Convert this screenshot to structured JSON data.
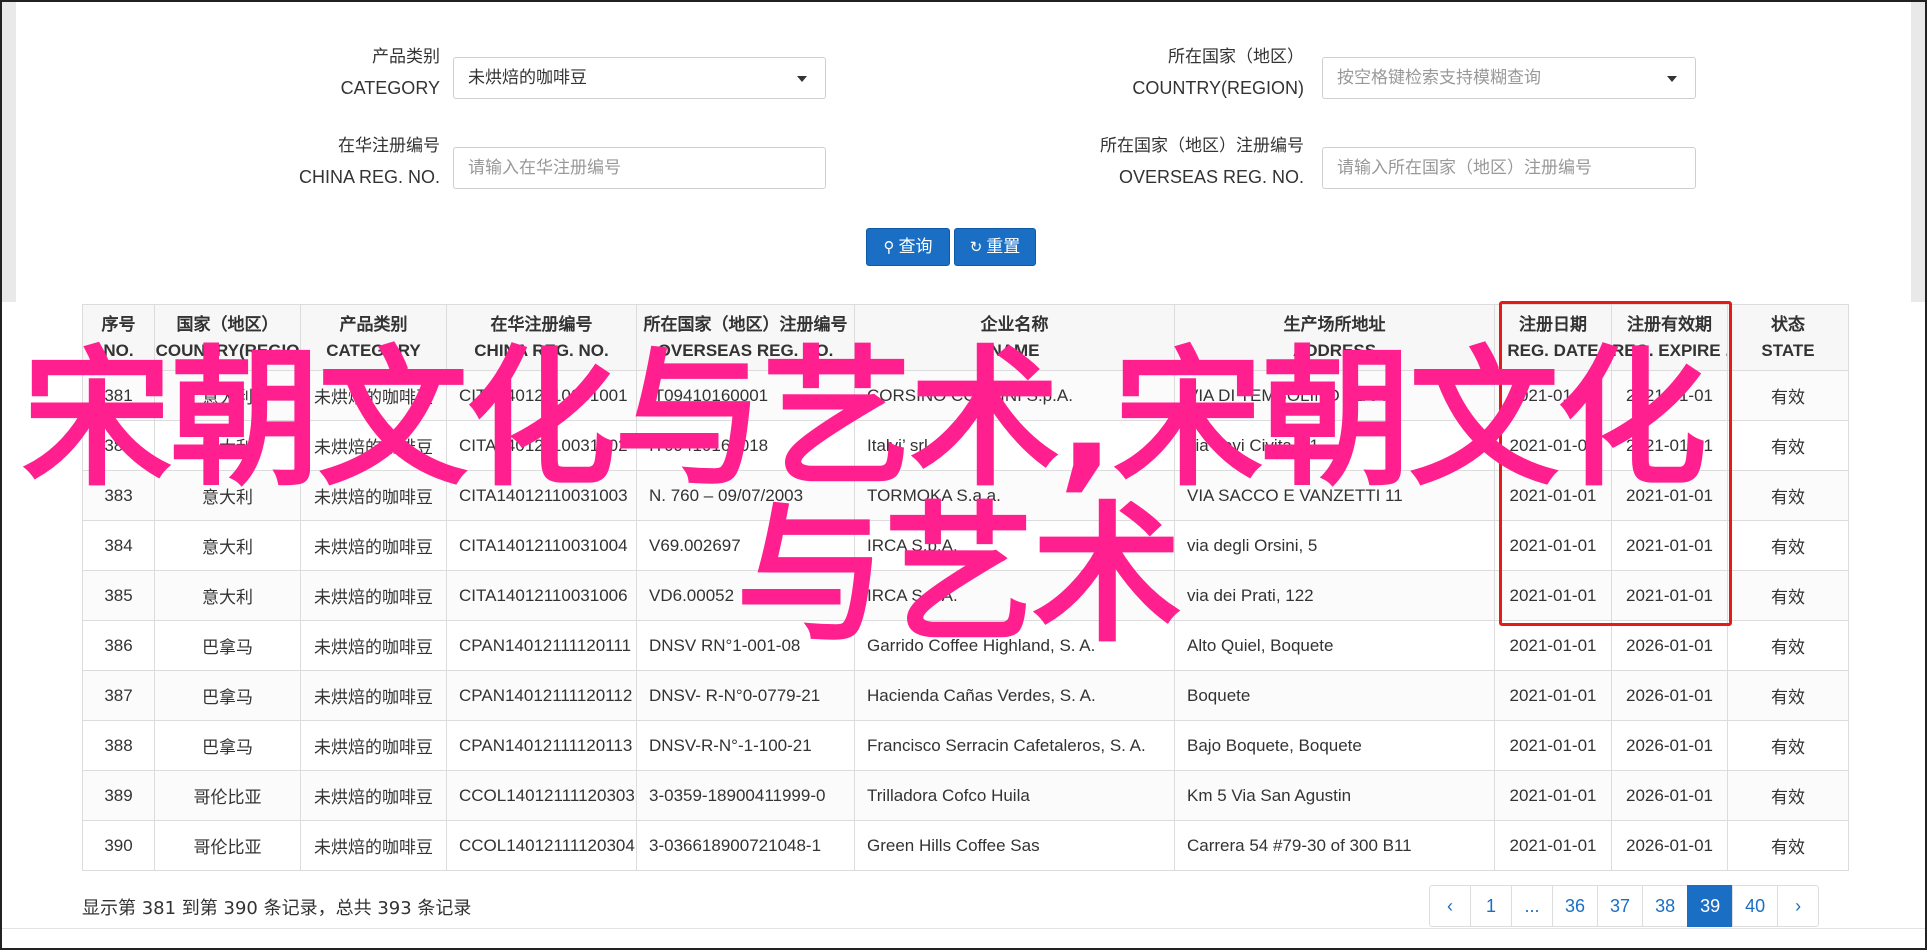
{
  "form": {
    "category": {
      "label_cn": "产品类别",
      "label_en": "CATEGORY",
      "value": "未烘焙的咖啡豆"
    },
    "country": {
      "label_cn": "所在国家（地区）",
      "label_en": "COUNTRY(REGION)",
      "placeholder": "按空格键检索支持模糊查询"
    },
    "china_reg": {
      "label_cn": "在华注册编号",
      "label_en": "CHINA REG. NO.",
      "placeholder": "请输入在华注册编号"
    },
    "overseas_reg": {
      "label_cn": "所在国家（地区）注册编号",
      "label_en": "OVERSEAS REG. NO.",
      "placeholder": "请输入所在国家（地区）注册编号"
    },
    "search_label": "查询",
    "reset_label": "重置"
  },
  "table": {
    "headers": [
      {
        "cn": "序号",
        "en": "NO."
      },
      {
        "cn": "国家（地区）",
        "en": "COUNTRY(REGIO"
      },
      {
        "cn": "产品类别",
        "en": "CATEGORY"
      },
      {
        "cn": "在华注册编号",
        "en": "CHINA REG. NO."
      },
      {
        "cn": "所在国家（地区）注册编号",
        "en": "OVERSEAS REG. NO."
      },
      {
        "cn": "企业名称",
        "en": "NAME"
      },
      {
        "cn": "生产场所地址",
        "en": "ADDRESS"
      },
      {
        "cn": "注册日期",
        "en": "REG. DATE"
      },
      {
        "cn": "注册有效期",
        "en": "REG. EXPIRE ..."
      },
      {
        "cn": "状态",
        "en": "STATE"
      }
    ],
    "rows": [
      {
        "no": "381",
        "country": "意大利",
        "category": "未烘焙的咖啡豆",
        "china_reg": "CITA14012110031001",
        "overseas_reg": "IT09410160001",
        "name": "CORSINO CORSINI S.p.A.",
        "address": "VIA DI TEMBOLINO 52/64",
        "reg_date": "2021-01-01",
        "expire": "2021-01-01",
        "state": "有效"
      },
      {
        "no": "382",
        "country": "意大利",
        "category": "未烘焙的咖啡豆",
        "china_reg": "CITA14012110031002",
        "overseas_reg": "IT09410160018",
        "name": "Italvi’ srl",
        "address": "via Levi Civita, 11",
        "reg_date": "2021-01-01",
        "expire": "2021-01-01",
        "state": "有效"
      },
      {
        "no": "383",
        "country": "意大利",
        "category": "未烘焙的咖啡豆",
        "china_reg": "CITA14012110031003",
        "overseas_reg": "N. 760 – 09/07/2003",
        "name": "TORMOKA S.a.a.",
        "address": "VIA SACCO E VANZETTI 11",
        "reg_date": "2021-01-01",
        "expire": "2021-01-01",
        "state": "有效"
      },
      {
        "no": "384",
        "country": "意大利",
        "category": "未烘焙的咖啡豆",
        "china_reg": "CITA14012110031004",
        "overseas_reg": "V69.002697",
        "name": "IRCA S.p.A.",
        "address": "via degli Orsini, 5",
        "reg_date": "2021-01-01",
        "expire": "2021-01-01",
        "state": "有效"
      },
      {
        "no": "385",
        "country": "意大利",
        "category": "未烘焙的咖啡豆",
        "china_reg": "CITA14012110031006",
        "overseas_reg": "VD6.00052",
        "name": "IRCA S.p.A.",
        "address": "via dei Prati, 122",
        "reg_date": "2021-01-01",
        "expire": "2021-01-01",
        "state": "有效"
      },
      {
        "no": "386",
        "country": "巴拿马",
        "category": "未烘焙的咖啡豆",
        "china_reg": "CPAN14012111120111",
        "overseas_reg": "DNSV RN°1-001-08",
        "name": "Garrido Coffee Highland, S. A.",
        "address": "Alto Quiel, Boquete",
        "reg_date": "2021-01-01",
        "expire": "2026-01-01",
        "state": "有效"
      },
      {
        "no": "387",
        "country": "巴拿马",
        "category": "未烘焙的咖啡豆",
        "china_reg": "CPAN14012111120112",
        "overseas_reg": "DNSV- R-N°0-0779-21",
        "name": "Hacienda Cañas Verdes, S. A.",
        "address": "Boquete",
        "reg_date": "2021-01-01",
        "expire": "2026-01-01",
        "state": "有效"
      },
      {
        "no": "388",
        "country": "巴拿马",
        "category": "未烘焙的咖啡豆",
        "china_reg": "CPAN14012111120113",
        "overseas_reg": "DNSV-R-N°-1-100-21",
        "name": "Francisco Serracin Cafetaleros, S. A.",
        "address": "Bajo Boquete, Boquete",
        "reg_date": "2021-01-01",
        "expire": "2026-01-01",
        "state": "有效"
      },
      {
        "no": "389",
        "country": "哥伦比亚",
        "category": "未烘焙的咖啡豆",
        "china_reg": "CCOL14012111120303",
        "overseas_reg": "3-0359-18900411999-0",
        "name": "Trilladora Cofco Huila",
        "address": "Km 5 Via San Agustin",
        "reg_date": "2021-01-01",
        "expire": "2026-01-01",
        "state": "有效"
      },
      {
        "no": "390",
        "country": "哥伦比亚",
        "category": "未烘焙的咖啡豆",
        "china_reg": "CCOL14012111120304",
        "overseas_reg": "3-036618900721048-1",
        "name": "Green Hills Coffee Sas",
        "address": "Carrera 54 #79-30 of 300 B11",
        "reg_date": "2021-01-01",
        "expire": "2026-01-01",
        "state": "有效"
      }
    ]
  },
  "footer": {
    "summary": "显示第 381 到第 390 条记录，总共 393 条记录"
  },
  "pagination": [
    "‹",
    "1",
    "...",
    "36",
    "37",
    "38",
    "39",
    "40",
    "›"
  ],
  "pagination_active": "39",
  "overlay": {
    "line1": "宋朝文化与艺术,宋朝文化",
    "line2": "与艺术"
  },
  "colors": {
    "accent": "#1a6fc4",
    "highlight_box": "#e21b1b",
    "overlay_text": "#ff1f8e"
  }
}
